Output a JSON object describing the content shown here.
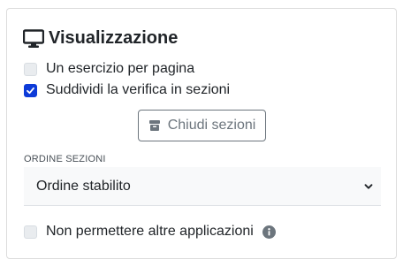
{
  "panel": {
    "title": "Visualizzazione",
    "title_icon": "monitor-icon"
  },
  "options": {
    "one_exercise_per_page": {
      "label": "Un esercizio per pagina",
      "checked": false
    },
    "split_into_sections": {
      "label": "Suddividi la verifica in sezioni",
      "checked": true
    },
    "no_other_apps": {
      "label": "Non permettere altre applicazioni",
      "checked": false,
      "icon": "info-icon"
    }
  },
  "close_sections_button": {
    "label": "Chiudi sezioni",
    "icon": "box-icon"
  },
  "section_order": {
    "label": "ORDINE SEZIONI",
    "selected": "Ordine stabilito"
  },
  "colors": {
    "accent": "#0d3bd8",
    "muted": "#6c757d"
  }
}
